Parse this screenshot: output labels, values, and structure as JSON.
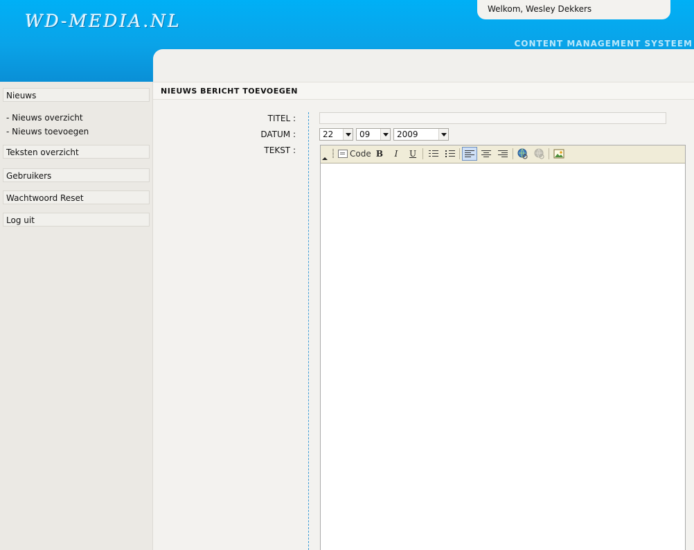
{
  "header": {
    "logo": "WD-MEDIA.NL",
    "welcome": "Welkom, Wesley Dekkers",
    "cms_title": "CONTENT MANAGEMENT SYSTEEM"
  },
  "sidebar": {
    "items": [
      {
        "label": "Nieuws"
      },
      {
        "label": "Teksten overzicht"
      },
      {
        "label": "Gebruikers"
      },
      {
        "label": "Wachtwoord Reset"
      },
      {
        "label": "Log uit"
      }
    ],
    "sub_items": [
      {
        "label": "- Nieuws overzicht"
      },
      {
        "label": "- Nieuws toevoegen"
      }
    ]
  },
  "main": {
    "section_title": "NIEUWS BERICHT TOEVOEGEN",
    "form": {
      "title_label": "TITEL :",
      "title_value": "",
      "date_label": "DATUM :",
      "day": "22",
      "month": "09",
      "year": "2009",
      "text_label": "TEKST :"
    },
    "editor": {
      "code_label": "Code",
      "bold_label": "B",
      "italic_label": "I",
      "underline_label": "U",
      "content": ""
    }
  },
  "colors": {
    "header_blue": "#00b0f6",
    "divider_blue": "#3c9dd8",
    "toolbar_bg": "#f0ecd8"
  }
}
